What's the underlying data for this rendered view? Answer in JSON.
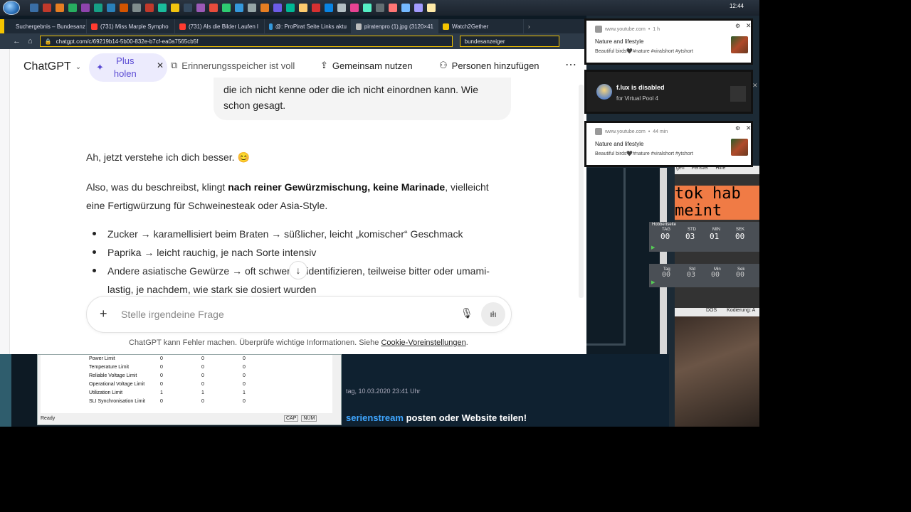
{
  "taskbar": {
    "clock": "12:44",
    "icon_colors": [
      "#3a6ea5",
      "#c0392b",
      "#e67e22",
      "#27ae60",
      "#8e44ad",
      "#16a085",
      "#2980b9",
      "#d35400",
      "#7f8c8d",
      "#c0392b",
      "#1abc9c",
      "#f1c40f",
      "#34495e",
      "#9b59b6",
      "#e74c3c",
      "#2ecc71",
      "#3498db",
      "#95a5a6",
      "#e67e22",
      "#6c5ce7",
      "#00b894",
      "#fdcb6e",
      "#d63031",
      "#0984e3",
      "#b2bec3",
      "#e84393",
      "#55efc4",
      "#636e72",
      "#ff7675",
      "#74b9ff",
      "#a29bfe",
      "#ffeaa7"
    ]
  },
  "browser": {
    "tabs": [
      {
        "label": "Suchergebnis – Bundesanz",
        "color": "#f5c400"
      },
      {
        "label": "(731) Miss Marple Sympho",
        "color": "#ff3b30"
      },
      {
        "label": "(731) Als die Bilder Laufen l",
        "color": "#ff3b30"
      },
      {
        "label": "@: ProPirat Seite Links aktu",
        "color": "#3498db"
      },
      {
        "label": "piratenpro (1).jpg (3120×41",
        "color": "#bbbbbb"
      },
      {
        "label": "Watch2Gether",
        "color": "#f5c400"
      }
    ],
    "url": "chatgpt.com/c/69219b14-5b00-832e-b7cf-ea0a7565cb5f",
    "search": "bundesanzeiger"
  },
  "chatgpt": {
    "brand": "ChatGPT",
    "plus_label_1": "Plus",
    "plus_label_2": "holen",
    "memory_full": "Erinnerungsspeicher ist voll",
    "share": "Gemeinsam nutzen",
    "add_people": "Personen hinzufügen",
    "user_bubble_line1": "die ich nicht kenne oder die ich nicht einordnen kann. Wie",
    "user_bubble_line2": "schon gesagt.",
    "reply_intro": "Ah, jetzt verstehe ich dich besser. 😊",
    "reply_p1_pre": "Also, was du beschreibst, klingt ",
    "reply_p1_bold": "nach reiner Gewürzmischung, keine Marinade",
    "reply_p1_post": ", vielleicht",
    "reply_p1_line2": "eine Fertigwürzung für Schweinesteak oder Asia-Style.",
    "bullets": [
      "Zucker → karamellisiert beim Braten → süßlicher, leicht „komischer“ Geschmack",
      "Paprika → leicht rauchig, je nach Sorte intensiv",
      "Andere asiatische Gewürze → oft schwer zu identifizieren, teilweise bitter oder umami-"
    ],
    "bullet3_line2": "lastig, je nachdem, wie stark sie dosiert wurden",
    "composer_placeholder": "Stelle irgendeine Frage",
    "disclaimer": "ChatGPT kann Fehler machen. Überprüfe wichtige Informationen. Siehe ",
    "cookie_link": "Cookie-Voreinstellungen",
    "disclaimer_end": "."
  },
  "gpu_window": {
    "rows": [
      {
        "name": "Power Limit",
        "v1": "0",
        "v2": "0",
        "v3": "0"
      },
      {
        "name": "Temperature Limit",
        "v1": "0",
        "v2": "0",
        "v3": "0"
      },
      {
        "name": "Reliable Voltage Limit",
        "v1": "0",
        "v2": "0",
        "v3": "0"
      },
      {
        "name": "Operational Voltage Limit",
        "v1": "0",
        "v2": "0",
        "v3": "0"
      },
      {
        "name": "Utilization Limit",
        "v1": "1",
        "v2": "1",
        "v3": "1"
      },
      {
        "name": "SLI Synchronisation Limit",
        "v1": "0",
        "v2": "0",
        "v3": "0"
      }
    ],
    "status": "Ready",
    "cap": "CAP",
    "num": "NUM"
  },
  "background": {
    "date_text": "tag, 10.03.2020 23:41 Uhr",
    "post_blue": "serienstream",
    "post_rest": " posten oder Website teilen!",
    "editor_menu": [
      "gen",
      "Fenster",
      "Hilfe"
    ],
    "editor_text_1": "tok hab",
    "editor_text_2": "meint",
    "editor_status_1": "DOS",
    "editor_status_2": "Kodierung: A"
  },
  "timer1": {
    "title": "Hobbertseite",
    "headers": [
      "TAG",
      "STD",
      "MIN",
      "SEK"
    ],
    "values": [
      "00",
      "03",
      "01",
      "00"
    ]
  },
  "timer2": {
    "headers": [
      "Tag",
      "Std",
      "Min",
      "Sek"
    ],
    "values": [
      "00",
      "03",
      "00",
      "00"
    ]
  },
  "notifications": [
    {
      "source": "www.youtube.com",
      "age": "1 h",
      "title": "Nature and lifestyle",
      "body": "Beautiful birds🖤#nature #viralshort #ytshort"
    },
    {
      "source": "www.youtube.com",
      "age": "44 min",
      "title": "Nature and lifestyle",
      "body": "Beautiful birds🖤#nature #viralshort #ytshort"
    }
  ],
  "flux": {
    "title": "f.lux is disabled",
    "subtitle": "for Virtual Pool 4"
  }
}
